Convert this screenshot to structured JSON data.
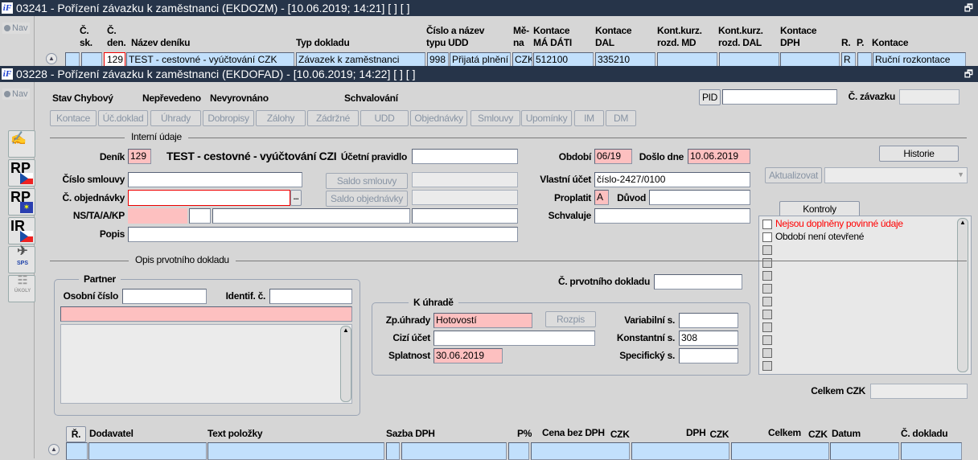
{
  "window1": {
    "title": "03241 - Pořízení závazku k zaměstnanci (EKDOZM) - [10.06.2019; 14:21]  [ ]  [ ]",
    "nav": "Nav",
    "headers": {
      "c_sk": "Č.\nsk.",
      "c_den_1": "Č.",
      "c_den_2": "den.",
      "c_sk_1": "Č.",
      "c_sk_2": "sk.",
      "nazev": "Název deníku",
      "typ": "Typ dokladu",
      "udd_1": "Číslo a název",
      "udd_2": "typu UDD",
      "mena_1": "Mě-",
      "mena_2": "na",
      "md_1": "Kontace",
      "md_2": "MÁ DÁTI",
      "dal_1": "Kontace",
      "dal_2": "DAL",
      "kmd_1": "Kont.kurz.",
      "kmd_2": "rozd. MD",
      "kdal_1": "Kont.kurz.",
      "kdal_2": "rozd. DAL",
      "dph_1": "Kontace",
      "dph_2": "DPH",
      "r": "R.",
      "p": "P.",
      "kontace": "Kontace"
    },
    "row": {
      "c_sk": "",
      "c_den": "129",
      "nazev": "TEST - cestovné - vyúčtování CZK",
      "typ": "Závazek k zaměstnanci",
      "udd_cislo": "998",
      "udd_nazev": "Přijatá plnění z",
      "mena": "CZK",
      "md": "512100",
      "dal": "335210",
      "kmd": "",
      "kdal": "",
      "dph": "",
      "r": "R",
      "p": "",
      "kontace": "Ruční rozkontace"
    }
  },
  "window2": {
    "title": "03228 - Pořízení závazku k zaměstnanci (EKDOFAD) - [10.06.2019; 14:22]  [ ]  [ ]",
    "nav": "Nav",
    "status": {
      "stav": "Stav",
      "chybovy": "Chybový",
      "neprevedeno": "Nepřevedeno",
      "nevyrovnano": "Nevyrovnáno",
      "schvalovani": "Schvalování"
    },
    "pid_label": "PID",
    "pid_value": "",
    "c_zavazku_label": "Č. závazku",
    "c_zavazku": "",
    "buttons": [
      "Kontace",
      "Úč.doklad",
      "Úhrady",
      "Dobropisy",
      "Zálohy",
      "Zádržné",
      "UDD",
      "Objednávky",
      "Smlouvy",
      "Upomínky",
      "IM",
      "DM"
    ],
    "side_icons": [
      "RP",
      "RP",
      "IR",
      "SPS",
      "ÚKOLY"
    ],
    "interni": {
      "section": "Interní údaje",
      "denik_label": "Deník",
      "denik": "129",
      "denik_name": "TEST - cestovné - vyúčtování CZI",
      "ucetni_pravidlo_label": "Účetní pravidlo",
      "ucetni_pravidlo": "",
      "cislo_smlouvy_label": "Číslo smlouvy",
      "cislo_smlouvy": "",
      "saldo_smlouvy": "Saldo smlouvy",
      "c_objednavky_label": "Č. objednávky",
      "c_objednavky": "",
      "ellipsis": "...",
      "saldo_objednavky": "Saldo objednávky",
      "ns_label": "NS/TA/A/KP",
      "popis_label": "Popis",
      "popis": "",
      "obdobi_label": "Období",
      "obdobi": "06/19",
      "doslo_label": "Došlo dne",
      "doslo": "10.06.2019",
      "vlastni_ucet_label": "Vlastní účet",
      "vlastni_ucet": "číslo-2427/0100",
      "proplatit_label": "Proplatit",
      "proplatit": "A",
      "duvod_label": "Důvod",
      "duvod": "",
      "schvaluje_label": "Schvaluje",
      "schvaluje": ""
    },
    "historie": "Historie",
    "aktualizovat": "Aktualizovat",
    "kontroly": {
      "tab": "Kontroly",
      "items": [
        {
          "text": "Nejsou doplněny povinné údaje",
          "error": true
        },
        {
          "text": "Období není otevřené",
          "error": false
        }
      ]
    },
    "opis": {
      "section": "Opis prvotního dokladu",
      "partner": "Partner",
      "osobni_cislo_label": "Osobní číslo",
      "identif_label": "Identif. č.",
      "c_prvotniho_label": "Č. prvotního dokladu",
      "k_uhrade": "K úhradě",
      "zp_uhrady_label": "Zp.úhrady",
      "zp_uhrady": "Hotovostí",
      "rozpis": "Rozpis",
      "variabilni_label": "Variabilní s.",
      "variabilni": "",
      "cizi_ucet_label": "Cizí účet",
      "cizi_ucet": "",
      "konstantni_label": "Konstantní s.",
      "konstantni": "308",
      "splatnost_label": "Splatnost",
      "splatnost": "30.06.2019",
      "specificky_label": "Specifický s.",
      "specificky": ""
    },
    "celkem_label": "Celkem",
    "celkem_currency": "CZK",
    "celkem": "",
    "items_table": {
      "r": "Ř.",
      "dodavatel": "Dodavatel",
      "text": "Text položky",
      "sazba": "Sazba DPH",
      "p": "P%",
      "cena": "Cena bez DPH",
      "dph": "DPH",
      "celkem": "Celkem",
      "currency": "CZK",
      "datum": "Datum",
      "c_dokladu": "Č. dokladu"
    }
  },
  "colors": {
    "titlebar": "#263449",
    "field_blue": "#c2e0fc",
    "field_required": "#fdc0c0",
    "error_text": "#ff0000"
  }
}
